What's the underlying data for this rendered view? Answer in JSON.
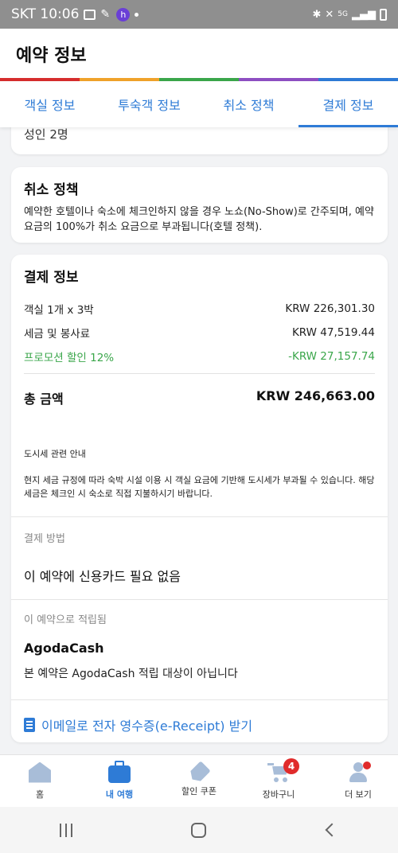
{
  "status_bar": {
    "carrier_time": "SKT 10:06",
    "network": "5G"
  },
  "header": {
    "title": "예약 정보"
  },
  "colors": {
    "accent": "#2e7bd6",
    "promo": "#3aa64a",
    "rainbow": [
      "#d62d2d",
      "#f0a22a",
      "#3aa64a",
      "#8e4fc2",
      "#2e7bd6"
    ]
  },
  "tabs": [
    {
      "label": "객실 정보",
      "active": false
    },
    {
      "label": "투숙객 정보",
      "active": false
    },
    {
      "label": "취소 정책",
      "active": false
    },
    {
      "label": "결제 정보",
      "active": true
    }
  ],
  "guests": {
    "text": "성인 2명"
  },
  "cancellation": {
    "title": "취소 정책",
    "text": "예약한 호텔이나 숙소에 체크인하지 않을 경우 노쇼(No-Show)로 간주되며, 예약 요금의 100%가 취소 요금으로 부과됩니다(호텔 정책)."
  },
  "payment": {
    "title": "결제 정보",
    "rows": [
      {
        "label": "객실 1개 x 3박",
        "amount": "KRW 226,301.30"
      },
      {
        "label": "세금 및 봉사료",
        "amount": "KRW 47,519.44"
      },
      {
        "label": "프로모션 할인 12%",
        "amount": "-KRW 27,157.74"
      }
    ],
    "total_label": "총 금액",
    "total_amount": "KRW 246,663.00",
    "tax_notice_title": "도시세 관련 안내",
    "tax_notice_body": "현지 세금 규정에 따라 숙박 시설 이용 시 객실 요금에 기반해 도시세가 부과될 수 있습니다. 해당 세금은 체크인 시 숙소로 직접 지불하시기 바랍니다.",
    "method_label": "결제 방법",
    "method_value": "이 예약에 신용카드 필요 없음",
    "earn_label": "이 예약으로 적립됨",
    "earn_brand": "AgodaCash",
    "earn_note": "본 예약은 AgodaCash 적립 대상이 아닙니다",
    "receipt_link": "이메일로 전자 영수증(e-Receipt) 받기"
  },
  "bottom_nav": [
    {
      "label": "홈",
      "icon": "home-icon"
    },
    {
      "label": "내 여행",
      "icon": "suitcase-icon",
      "active": true
    },
    {
      "label": "할인 쿠폰",
      "icon": "tag-icon"
    },
    {
      "label": "장바구니",
      "icon": "cart-icon",
      "badge": "4"
    },
    {
      "label": "더 보기",
      "icon": "person-icon"
    }
  ]
}
